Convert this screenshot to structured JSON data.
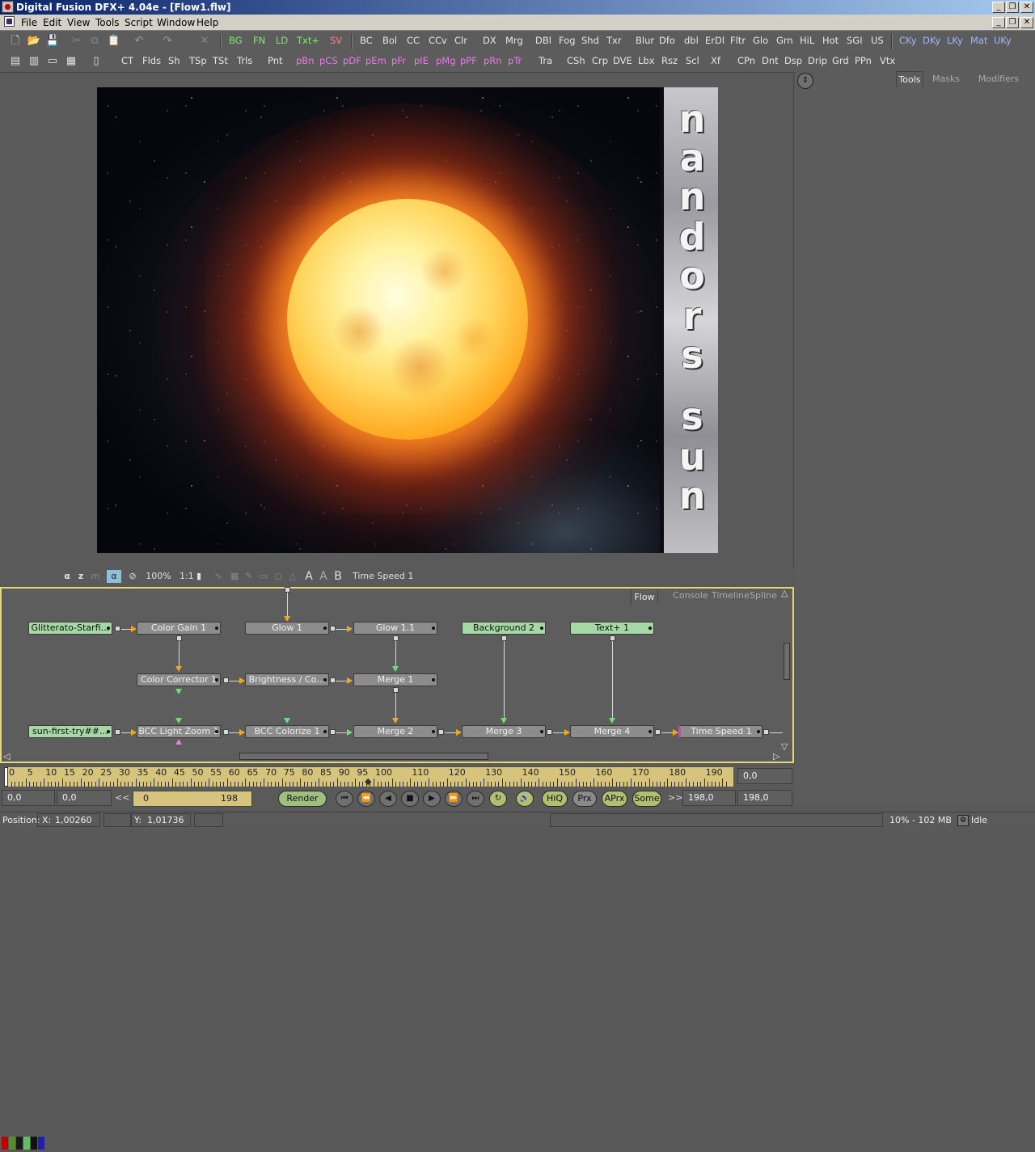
{
  "window": {
    "title": "Digital Fusion DFX+ 4.04e - [Flow1.flw]"
  },
  "menu": [
    "File",
    "Edit",
    "View",
    "Tools",
    "Script",
    "Window",
    "Help"
  ],
  "toolbar1": {
    "green": [
      "BG",
      "FN",
      "LD",
      "Txt+"
    ],
    "red": [
      "SV"
    ],
    "plain": [
      "BC",
      "Bol",
      "CC",
      "CCv",
      "Clr",
      "DX",
      "Mrg",
      "DBl",
      "Fog",
      "Shd",
      "Txr",
      "Blur",
      "Dfo",
      "dbl",
      "ErDl",
      "Fltr",
      "Glo",
      "Grn",
      "HiL",
      "Hot",
      "SGI",
      "US"
    ],
    "blue": [
      "CKy",
      "DKy",
      "LKy",
      "Mat",
      "UKy"
    ]
  },
  "toolbar2": {
    "plain_a": [
      "CT",
      "Flds",
      "Sh",
      "TSp",
      "TSt",
      "Trls",
      "Pnt"
    ],
    "pink": [
      "pBn",
      "pCS",
      "pDF",
      "pEm",
      "pFr",
      "pIE",
      "pMg",
      "pPF",
      "pRn",
      "pTr"
    ],
    "plain_b": [
      "Tra",
      "CSh",
      "Crp",
      "DVE",
      "Lbx",
      "Rsz",
      "Scl",
      "Xf",
      "CPn",
      "Dnt",
      "Dsp",
      "Drip",
      "Grd",
      "PPn",
      "Vtx"
    ]
  },
  "viewer": {
    "title_text": [
      "n",
      "a",
      "n",
      "d",
      "o",
      "r",
      "s",
      "s",
      "u",
      "n"
    ],
    "zoom": "100%",
    "ratio": "1:1",
    "letters": [
      "α",
      "z",
      "m",
      "α"
    ],
    "abbuttons": [
      "A",
      "A",
      "B"
    ],
    "label": "Time Speed 1"
  },
  "right_tabs": [
    "Tools",
    "Masks",
    "Modifiers"
  ],
  "flow_tabs": [
    "Flow",
    "Console",
    "Timeline",
    "Spline"
  ],
  "nodes": {
    "glitterato": "Glitterato-Starfi…",
    "color_gain": "Color Gain 1",
    "glow1": "Glow 1",
    "glow11": "Glow 1.1",
    "background2": "Background 2",
    "text1": "Text+ 1",
    "color_corrector": "Color Corrector 1",
    "brightness": "Brightness / Co…",
    "merge1": "Merge 1",
    "sun_loader": "sun-first-try##…",
    "bcc_lightzoom": "BCC Light Zoom 1",
    "bcc_colorize": "BCC Colorize 1",
    "merge2": "Merge 2",
    "merge3": "Merge 3",
    "merge4": "Merge 4",
    "timespeed": "Time Speed 1"
  },
  "timeline": {
    "ticks": [
      0,
      5,
      10,
      15,
      20,
      25,
      30,
      35,
      40,
      45,
      50,
      55,
      60,
      65,
      70,
      75,
      80,
      85,
      90,
      95,
      100,
      110,
      120,
      130,
      140,
      150,
      160,
      170,
      180,
      190
    ],
    "current_field": "0,0"
  },
  "transport": {
    "left1": "0,0",
    "left2": "0,0",
    "range_start": "0",
    "range_end": "198",
    "render": "Render",
    "pills": [
      "HiQ",
      "Prx",
      "APrx",
      "Some"
    ],
    "end1": "198,0",
    "end2": "198,0",
    "prev_marker": "<<",
    "next_marker": ">>"
  },
  "status": {
    "position_label": "Position:",
    "x_label": "X:",
    "x": "1,00260",
    "y_label": "Y:",
    "y": "1,01736",
    "memory": "10% - 102 MB",
    "state": "Idle"
  }
}
